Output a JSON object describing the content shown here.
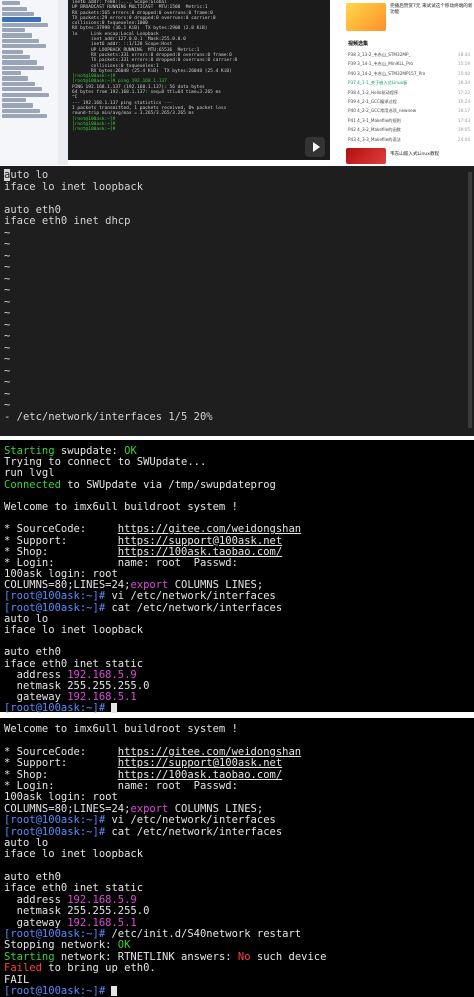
{
  "top_panel": {
    "terminal_lines": [
      "inet6 addr: fe80::..., Scope:Global",
      "UP BROADCAST RUNNING MULTICAST  MTU:1500  Metric:1",
      "RX packets:565 errors:0 dropped:0 overruns:0 frame:0",
      "TX packets:29 errors:0 dropped:0 overruns:0 carrier:0",
      "collisions:0 txqueuelen:1000",
      "RX bytes:37998 (36.1 KiB)  TX bytes:2908 (2.8 KiB)",
      "",
      "lo     Link encap:Local Loopback",
      "       inet addr:127.0.0.1  Mask:255.0.0.0",
      "       inet6 addr: ::1/128 Scope:Host",
      "       UP LOOPBACK RUNNING  MTU:65536  Metric:1",
      "       RX packets:331 errors:0 dropped:0 overruns:0 frame:0",
      "       TX packets:331 errors:0 dropped:0 overruns:0 carrier:0",
      "       collisions:0 txqueuelen:1",
      "       RX bytes:26048 (25.4 KiB)  TX bytes:26048 (25.4 KiB)",
      "",
      "[root@100ask:~]#",
      "[root@100ask:~]# ping 192.168.1.137",
      "PING 192.168.1.137 (192.168.1.137): 56 data bytes",
      "64 bytes from 192.168.1.137: seq=0 ttl=64 time=3.265 ms",
      "^C",
      "--- 192.168.1.137 ping statistics ---",
      "1 packets transmitted, 1 packets received, 0% packet loss",
      "round-trip min/avg/max = 3.265/3.265/3.265 ms",
      "[root@100ask:~]#",
      "[root@100ask:~]#",
      "[root@100ask:~]#"
    ],
    "right_panel": {
      "top_title": "完播后赞赏7元 来试试这个移动终端的新功能",
      "heading": "视频选集",
      "episodes": [
        {
          "label": "P38  3_13-2_韦东山_STM32MP_",
          "time": "18:44",
          "active": false
        },
        {
          "label": "P39  3_14-1_韦东山_MiniKLL_Pro",
          "time": "15:19",
          "active": false
        },
        {
          "label": "P40  3_14-2_韦东山_STM32MP157_Pro",
          "time": "15:40",
          "active": false
        },
        {
          "label": "P37  4_1-1_关于嵌入式Linux板",
          "time": "16:34",
          "active": true
        },
        {
          "label": "P38  4_1-2_Hello驱动程序",
          "time": "17:22",
          "active": false
        },
        {
          "label": "P39  4_2-1_GCC编译过程",
          "time": "15:24",
          "active": false
        },
        {
          "label": "P40  4_2-2_GCC常用选项_newnew",
          "time": "16:17",
          "active": false
        },
        {
          "label": "P41  4_3-1_Makefile的规则",
          "time": "17:43",
          "active": false
        },
        {
          "label": "P42  4_3-2_Makefile的函数",
          "time": "19:05",
          "active": false
        },
        {
          "label": "P43  4_3-3_Makefile的语法",
          "time": "24:04",
          "active": false
        }
      ],
      "bottom_title": "韦东山嵌入式Linux教程"
    }
  },
  "vi_editor": {
    "lines": [
      "auto lo",
      "iface lo inet loopback",
      "",
      "auto eth0",
      "iface eth0 inet dhcp"
    ],
    "tilde_count": 16,
    "status_line": "- /etc/network/interfaces 1/5 20%"
  },
  "terminal2": {
    "lines": [
      [
        {
          "t": "Starting",
          "c": "green"
        },
        {
          "t": " swupdate: "
        },
        {
          "t": "OK",
          "c": "green"
        }
      ],
      [
        {
          "t": "Trying to connect to SWUpdate..."
        }
      ],
      [
        {
          "t": "run lvgl"
        }
      ],
      [
        {
          "t": "Connected",
          "c": "green"
        },
        {
          "t": " to SWUpdate via /tmp/swupdateprog"
        }
      ],
      [
        {
          "t": ""
        }
      ],
      [
        {
          "t": "Welcome to imx6ull buildroot system !"
        }
      ],
      [
        {
          "t": ""
        }
      ],
      [
        {
          "t": "* SourceCode:     "
        },
        {
          "t": "https://gitee.com/weidongshan",
          "c": "ul"
        }
      ],
      [
        {
          "t": "* Support:        "
        },
        {
          "t": "https://support@100ask.net",
          "c": "ul"
        }
      ],
      [
        {
          "t": "* Shop:           "
        },
        {
          "t": "https://100ask.taobao.com/",
          "c": "ul"
        }
      ],
      [
        {
          "t": "* Login:          name: root  Passwd:"
        }
      ],
      [
        {
          "t": "100ask login: root"
        }
      ],
      [
        {
          "t": "COLUMNS=80;LINES=24;"
        },
        {
          "t": "export",
          "c": "magenta"
        },
        {
          "t": " COLUMNS LINES;"
        }
      ],
      [
        {
          "t": "[root@100ask:~]#",
          "c": "blue"
        },
        {
          "t": " vi /etc/network/interfaces"
        }
      ],
      [
        {
          "t": "[root@100ask:~]#",
          "c": "blue"
        },
        {
          "t": " cat /etc/network/interfaces"
        }
      ],
      [
        {
          "t": "auto lo"
        }
      ],
      [
        {
          "t": "iface lo inet loopback"
        }
      ],
      [
        {
          "t": ""
        }
      ],
      [
        {
          "t": "auto eth0"
        }
      ],
      [
        {
          "t": "iface eth0 inet static"
        }
      ],
      [
        {
          "t": "  address "
        },
        {
          "t": "192.168.5.9",
          "c": "magenta"
        }
      ],
      [
        {
          "t": "  netmask 255.255.255.0"
        }
      ],
      [
        {
          "t": "  gateway "
        },
        {
          "t": "192.168.5.1",
          "c": "magenta"
        }
      ],
      [
        {
          "t": "[root@100ask:~]#",
          "c": "blue"
        },
        {
          "t": " ",
          "cursor": true
        }
      ]
    ]
  },
  "terminal3": {
    "lines": [
      [
        {
          "t": "Welcome to imx6ull buildroot system !"
        }
      ],
      [
        {
          "t": ""
        }
      ],
      [
        {
          "t": "* SourceCode:     "
        },
        {
          "t": "https://gitee.com/weidongshan",
          "c": "ul"
        }
      ],
      [
        {
          "t": "* Support:        "
        },
        {
          "t": "https://support@100ask.net",
          "c": "ul"
        }
      ],
      [
        {
          "t": "* Shop:           "
        },
        {
          "t": "https://100ask.taobao.com/",
          "c": "ul"
        }
      ],
      [
        {
          "t": "* Login:          name: root  Passwd:"
        }
      ],
      [
        {
          "t": "100ask login: root"
        }
      ],
      [
        {
          "t": "COLUMNS=80;LINES=24;"
        },
        {
          "t": "export",
          "c": "magenta"
        },
        {
          "t": " COLUMNS LINES;"
        }
      ],
      [
        {
          "t": "[root@100ask:~]#",
          "c": "blue"
        },
        {
          "t": " vi /etc/network/interfaces"
        }
      ],
      [
        {
          "t": "[root@100ask:~]#",
          "c": "blue"
        },
        {
          "t": " cat /etc/network/interfaces"
        }
      ],
      [
        {
          "t": "auto lo"
        }
      ],
      [
        {
          "t": "iface lo inet loopback"
        }
      ],
      [
        {
          "t": ""
        }
      ],
      [
        {
          "t": "auto eth0"
        }
      ],
      [
        {
          "t": "iface eth0 inet static"
        }
      ],
      [
        {
          "t": "  address "
        },
        {
          "t": "192.168.5.9",
          "c": "magenta"
        }
      ],
      [
        {
          "t": "  netmask 255.255.255.0"
        }
      ],
      [
        {
          "t": "  gateway "
        },
        {
          "t": "192.168.5.1",
          "c": "magenta"
        }
      ],
      [
        {
          "t": "[root@100ask:~]#",
          "c": "blue"
        },
        {
          "t": " /etc/init.d/S40network restart"
        }
      ],
      [
        {
          "t": "Stopping network: "
        },
        {
          "t": "OK",
          "c": "green"
        }
      ],
      [
        {
          "t": "Starting",
          "c": "green"
        },
        {
          "t": " network: RTNETLINK answers: "
        },
        {
          "t": "No",
          "c": "red"
        },
        {
          "t": " such device"
        }
      ],
      [
        {
          "t": "Failed",
          "c": "red"
        },
        {
          "t": " to bring up eth0."
        }
      ],
      [
        {
          "t": "FAIL"
        }
      ],
      [
        {
          "t": "[root@100ask:~]#",
          "c": "blue"
        },
        {
          "t": " ",
          "cursor": true
        }
      ]
    ]
  },
  "colors": {
    "green": "#39d339",
    "magenta": "#d94bd9",
    "red": "#ff4040",
    "prompt_blue": "#5a8cff",
    "vi_bg": "#1e1e1e",
    "terminal_bg": "#000000"
  },
  "icons": [
    "play-icon"
  ]
}
